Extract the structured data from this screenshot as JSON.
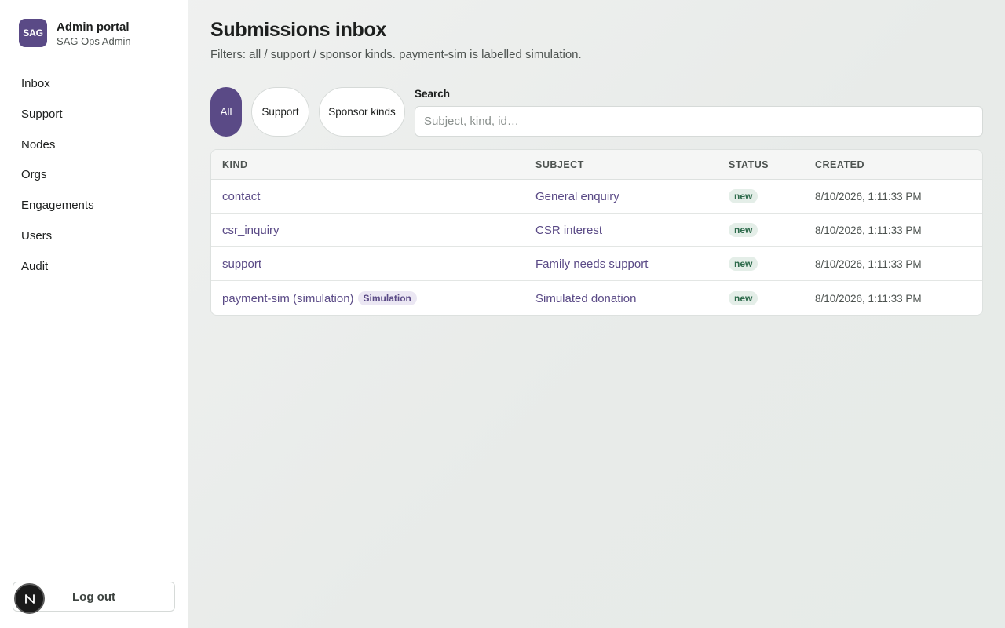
{
  "brand": {
    "logo_text": "SAG",
    "title": "Admin portal",
    "subtitle": "SAG Ops Admin"
  },
  "sidebar": {
    "items": [
      {
        "label": "Inbox"
      },
      {
        "label": "Support"
      },
      {
        "label": "Nodes"
      },
      {
        "label": "Orgs"
      },
      {
        "label": "Engagements"
      },
      {
        "label": "Users"
      },
      {
        "label": "Audit"
      }
    ],
    "logout_label": "Log out"
  },
  "header": {
    "title": "Submissions inbox",
    "subtitle": "Filters: all / support / sponsor kinds. payment-sim is labelled simulation."
  },
  "filters": {
    "chips": [
      {
        "label": "All",
        "active": true
      },
      {
        "label": "Support",
        "active": false
      },
      {
        "label": "Sponsor kinds",
        "active": false
      }
    ]
  },
  "search": {
    "label": "Search",
    "placeholder": "Subject, kind, id…",
    "value": ""
  },
  "table": {
    "columns": [
      "KIND",
      "SUBJECT",
      "STATUS",
      "CREATED"
    ],
    "rows": [
      {
        "kind": "contact",
        "tag": "",
        "subject": "General enquiry",
        "status": "new",
        "created": "8/10/2026, 1:11:33 PM"
      },
      {
        "kind": "csr_inquiry",
        "tag": "",
        "subject": "CSR interest",
        "status": "new",
        "created": "8/10/2026, 1:11:33 PM"
      },
      {
        "kind": "support",
        "tag": "",
        "subject": "Family needs support",
        "status": "new",
        "created": "8/10/2026, 1:11:33 PM"
      },
      {
        "kind": "payment-sim (simulation)",
        "tag": "Simulation",
        "subject": "Simulated donation",
        "status": "new",
        "created": "8/10/2026, 1:11:33 PM"
      }
    ]
  },
  "colors": {
    "accent": "#5a4a86",
    "status_new_bg": "#e4eee8",
    "status_new_text": "#2d6a4b"
  },
  "dev_badge": {
    "icon": "nextjs-n-icon",
    "letter": "N"
  }
}
